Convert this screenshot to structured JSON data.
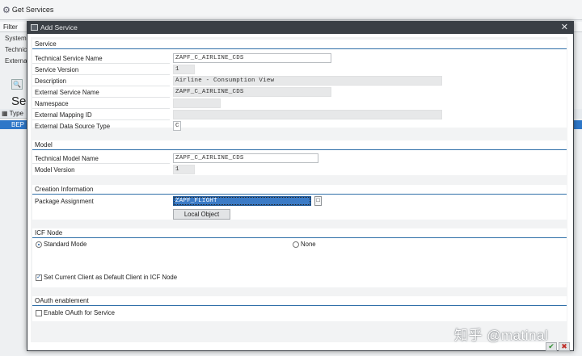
{
  "background": {
    "title": "Get Services",
    "filter_label": "Filter",
    "side_labels": [
      "System",
      "Technic",
      "Externa"
    ],
    "sel_label": "Sel",
    "type_header": "Type",
    "selected_row_type": "BEP"
  },
  "dialog": {
    "title": "Add Service",
    "close_glyph": "✕"
  },
  "service": {
    "title": "Service",
    "rows": [
      {
        "label": "Technical Service Name",
        "value": "ZAPF_C_AIRLINE_CDS"
      },
      {
        "label": "Service Version",
        "value": "1"
      },
      {
        "label": "Description",
        "value": "Airline - Consumption View"
      },
      {
        "label": "External Service Name",
        "value": "ZAPF_C_AIRLINE_CDS"
      },
      {
        "label": "Namespace",
        "value": ""
      },
      {
        "label": "External Mapping ID",
        "value": ""
      },
      {
        "label": "External Data Source Type",
        "value": "C"
      }
    ]
  },
  "model": {
    "title": "Model",
    "rows": [
      {
        "label": "Technical Model Name",
        "value": "ZAPF_C_AIRLINE_CDS"
      },
      {
        "label": "Model Version",
        "value": "1"
      }
    ]
  },
  "creation": {
    "title": "Creation Information",
    "package_label": "Package Assignment",
    "package_value": "ZAPF_FLIGHT",
    "f4_glyph": "□",
    "local_object_label": "Local Object"
  },
  "icf": {
    "title": "ICF Node",
    "standard_mode_label": "Standard Mode",
    "none_label": "None",
    "set_client_label": "Set Current Client as Default Client in ICF Node"
  },
  "oauth": {
    "title": "OAuth enablement",
    "enable_label": "Enable OAuth for Service"
  },
  "footer": {
    "ok_glyph": "✔",
    "cancel_glyph": "✖"
  },
  "watermark": "知乎 @matinal",
  "colors": {
    "accent": "#2f6fa8",
    "selection": "#3b7bc6",
    "dialog_title_bar": "#3a3f45"
  }
}
